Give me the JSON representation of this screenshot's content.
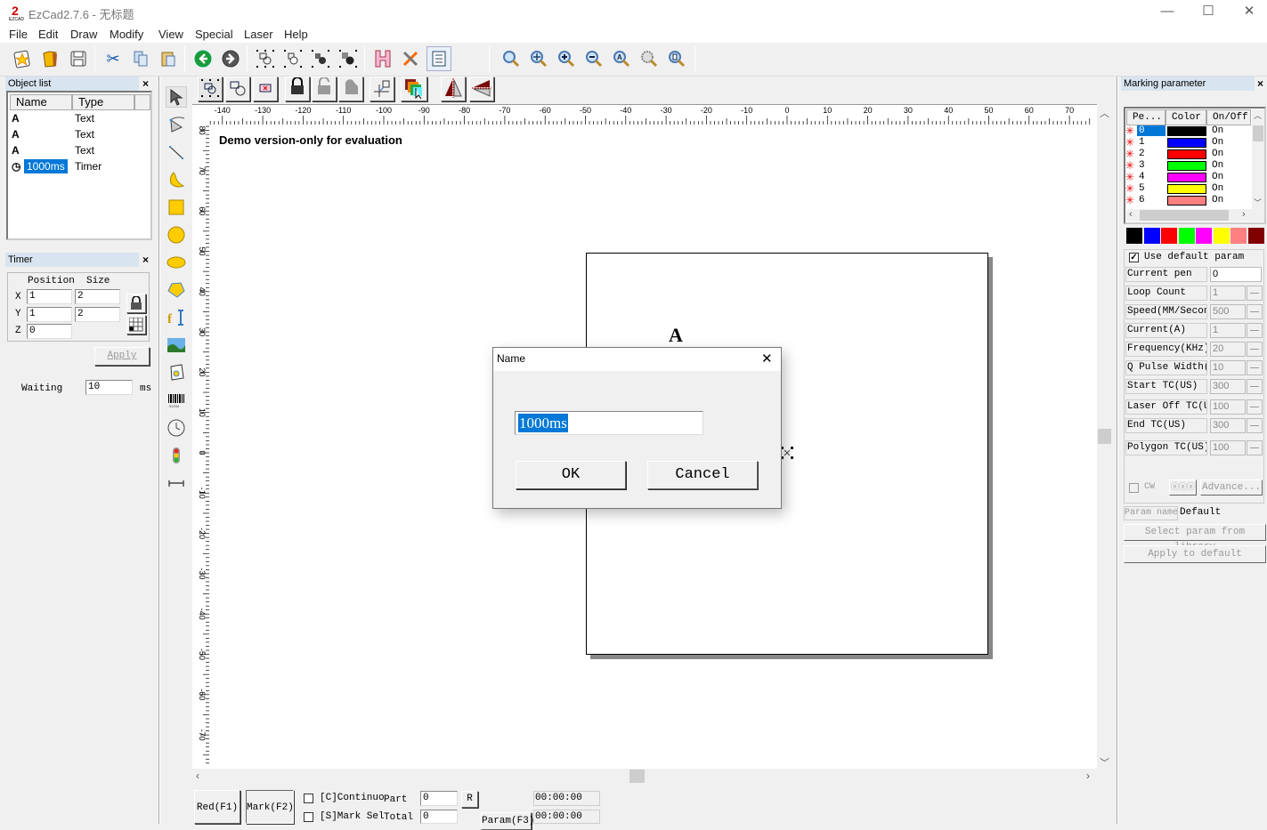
{
  "window": {
    "title": "EzCad2.7.6 - 无标题",
    "minimize": "—",
    "maximize": "☐",
    "close": "✕"
  },
  "menu": [
    "File",
    "Edit",
    "Draw",
    "Modify",
    "View",
    "Special",
    "Laser",
    "Help"
  ],
  "toolbar": {
    "icons": [
      "new-file",
      "open-file",
      "save",
      "cut",
      "copy",
      "paste",
      "back",
      "forward",
      "select-group-1",
      "select-group-2",
      "select-group-3",
      "select-group-4",
      "hatch",
      "settings-tools",
      "object-list-toggle",
      "zoom",
      "zoom-pan",
      "zoom-in",
      "zoom-out",
      "zoom-auto",
      "zoom-all",
      "zoom-page"
    ]
  },
  "object_list": {
    "title": "Object list",
    "close": "×",
    "columns": [
      "Name",
      "Type"
    ],
    "rows": [
      {
        "icon": "A",
        "name": "",
        "type": "Text"
      },
      {
        "icon": "A",
        "name": "",
        "type": "Text"
      },
      {
        "icon": "A",
        "name": "",
        "type": "Text"
      },
      {
        "icon": "◷",
        "name": "1000ms",
        "type": "Timer",
        "selected": true
      }
    ]
  },
  "timer_panel": {
    "title": "Timer",
    "close": "×",
    "position_label": "Position",
    "size_label": "Size",
    "x_label": "X",
    "y_label": "Y",
    "z_label": "Z",
    "pos_x": "1",
    "pos_y": "1",
    "pos_z": "0",
    "size_x": "2",
    "size_y": "2",
    "apply": "Apply",
    "waiting_label": "Waiting",
    "waiting_value": "10",
    "waiting_unit": "ms"
  },
  "canvas": {
    "watermark": "Demo version-only for evaluation",
    "glyph": "A",
    "h_ticks": [
      "-140",
      "-130",
      "-120",
      "-110",
      "-100",
      "-90",
      "-80",
      "-70",
      "-60",
      "-50",
      "-40",
      "-30",
      "-20",
      "-10",
      "0",
      "10",
      "20",
      "30",
      "40",
      "50",
      "60",
      "70"
    ],
    "v_ticks": [
      "80",
      "70",
      "60",
      "50",
      "40",
      "30",
      "20",
      "10",
      "0",
      "-10",
      "-20",
      "-30",
      "-40",
      "-50",
      "-60",
      "-70"
    ]
  },
  "dialog": {
    "title": "Name",
    "close": "✕",
    "input_value": "1000ms",
    "ok": "OK",
    "cancel": "Cancel"
  },
  "marking": {
    "title": "Marking parameter",
    "close": "×",
    "columns": [
      "Pe...",
      "Color",
      "On/Off"
    ],
    "pens": [
      {
        "id": "0",
        "color": "#000000",
        "state": "On"
      },
      {
        "id": "1",
        "color": "#0000ff",
        "state": "On"
      },
      {
        "id": "2",
        "color": "#ff0000",
        "state": "On"
      },
      {
        "id": "3",
        "color": "#00ff00",
        "state": "On"
      },
      {
        "id": "4",
        "color": "#ff00ff",
        "state": "On"
      },
      {
        "id": "5",
        "color": "#ffff00",
        "state": "On"
      },
      {
        "id": "6",
        "color": "#ff8080",
        "state": "On"
      }
    ],
    "palette": [
      "#000000",
      "#0000ff",
      "#ff0000",
      "#00ff00",
      "#ff00ff",
      "#ffff00",
      "#ff8080",
      "#800000"
    ],
    "use_default": "Use default param",
    "params": [
      {
        "label": "Current pen",
        "value": "0"
      },
      {
        "label": "Loop Count",
        "value": "1"
      },
      {
        "label": "Speed(MM/Second",
        "value": "500"
      },
      {
        "label": "Current(A)",
        "value": "1"
      },
      {
        "label": "Frequency(KHz)",
        "value": "20"
      },
      {
        "label": "Q Pulse Width(U",
        "value": "10"
      },
      {
        "label": "Start TC(US)",
        "value": "300"
      },
      {
        "label": "Laser Off TC(US",
        "value": "100"
      },
      {
        "label": "End TC(US)",
        "value": "300"
      },
      {
        "label": "Polygon TC(US)",
        "value": "100"
      }
    ],
    "cw": "CW",
    "advance": "Advance...",
    "param_name_label": "Param name",
    "param_name_value": "Default",
    "select_library": "Select param from library",
    "apply_default": "Apply to default"
  },
  "bottom": {
    "red": "Red(F1)",
    "mark": "Mark(F2)",
    "continuo": "[C]Continuo",
    "mark_sel": "[S]Mark Sel",
    "part_label": "Part",
    "part_value": "0",
    "total_label": "Total",
    "total_value": "0",
    "r": "R",
    "param": "Param(F3)",
    "time1": "00:00:00",
    "time2": "00:00:00"
  }
}
